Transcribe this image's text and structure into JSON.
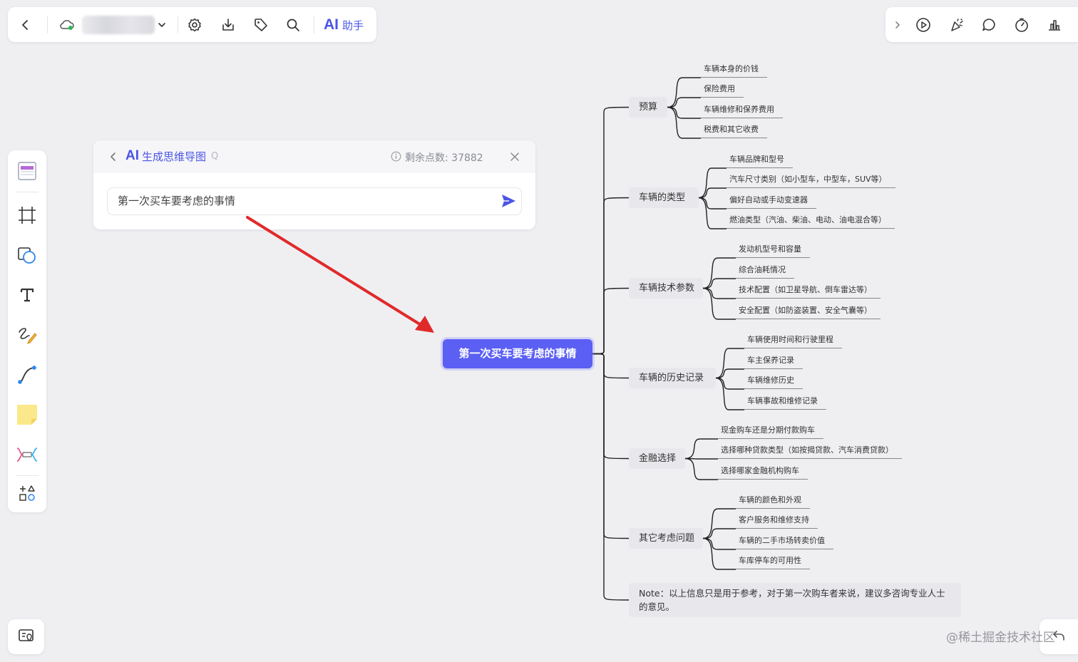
{
  "toolbar": {
    "ai_glyph": "AI",
    "ai_label": "助手",
    "icons": [
      "back-icon",
      "cloud-sync-icon",
      "chevron-down-icon",
      "settings-icon",
      "download-icon",
      "tag-icon",
      "search-icon"
    ]
  },
  "right_toolbar": {
    "icons": [
      "expand-icon",
      "play-icon",
      "celebrate-icon",
      "comment-icon",
      "timer-icon",
      "chart-icon"
    ]
  },
  "side_toolbar": {
    "tools": [
      "template-icon",
      "frame-icon",
      "shape-icon",
      "text-icon",
      "pen-icon",
      "connector-icon",
      "sticky-note-icon",
      "mindmap-icon",
      "more-shapes-icon"
    ]
  },
  "ai_panel": {
    "title_glyph": "AI",
    "title": "生成思维导图",
    "title_suffix": "Q",
    "credits": "剩余点数: 37882",
    "input_value": "第一次买车要考虑的事情"
  },
  "mindmap": {
    "root": "第一次买车要考虑的事情",
    "branches": [
      {
        "label": "预算",
        "children": [
          "车辆本身的价钱",
          "保险费用",
          "车辆维修和保养费用",
          "税费和其它收费"
        ]
      },
      {
        "label": "车辆的类型",
        "children": [
          "车辆品牌和型号",
          "汽车尺寸类别（如小型车，中型车，SUV等）",
          "偏好自动或手动变速器",
          "燃油类型（汽油、柴油、电动、油电混合等）"
        ]
      },
      {
        "label": "车辆技术参数",
        "children": [
          "发动机型号和容量",
          "综合油耗情况",
          "技术配置（如卫星导航、倒车雷达等）",
          "安全配置（如防盗装置、安全气囊等）"
        ]
      },
      {
        "label": "车辆的历史记录",
        "children": [
          "车辆使用时间和行驶里程",
          "车主保养记录",
          "车辆维修历史",
          "车辆事故和维修记录"
        ]
      },
      {
        "label": "金融选择",
        "children": [
          "现金购车还是分期付款购车",
          "选择哪种贷款类型（如按揭贷款、汽车消费贷款）",
          "选择哪家金融机构购车"
        ]
      },
      {
        "label": "其它考虑问题",
        "children": [
          "车辆的颜色和外观",
          "客户服务和维修支持",
          "车辆的二手市场转卖价值",
          "车库停车的可用性"
        ]
      }
    ],
    "note": "Note：以上信息只是用于参考，对于第一次购车者来说，建议多咨询专业人士的意见。"
  },
  "watermark": "@稀土掘金技术社区",
  "colors": {
    "accent": "#4a55e6",
    "root_node": "#5b5ff3",
    "arrow": "#e02a2a",
    "canvas": "#efeff2"
  }
}
